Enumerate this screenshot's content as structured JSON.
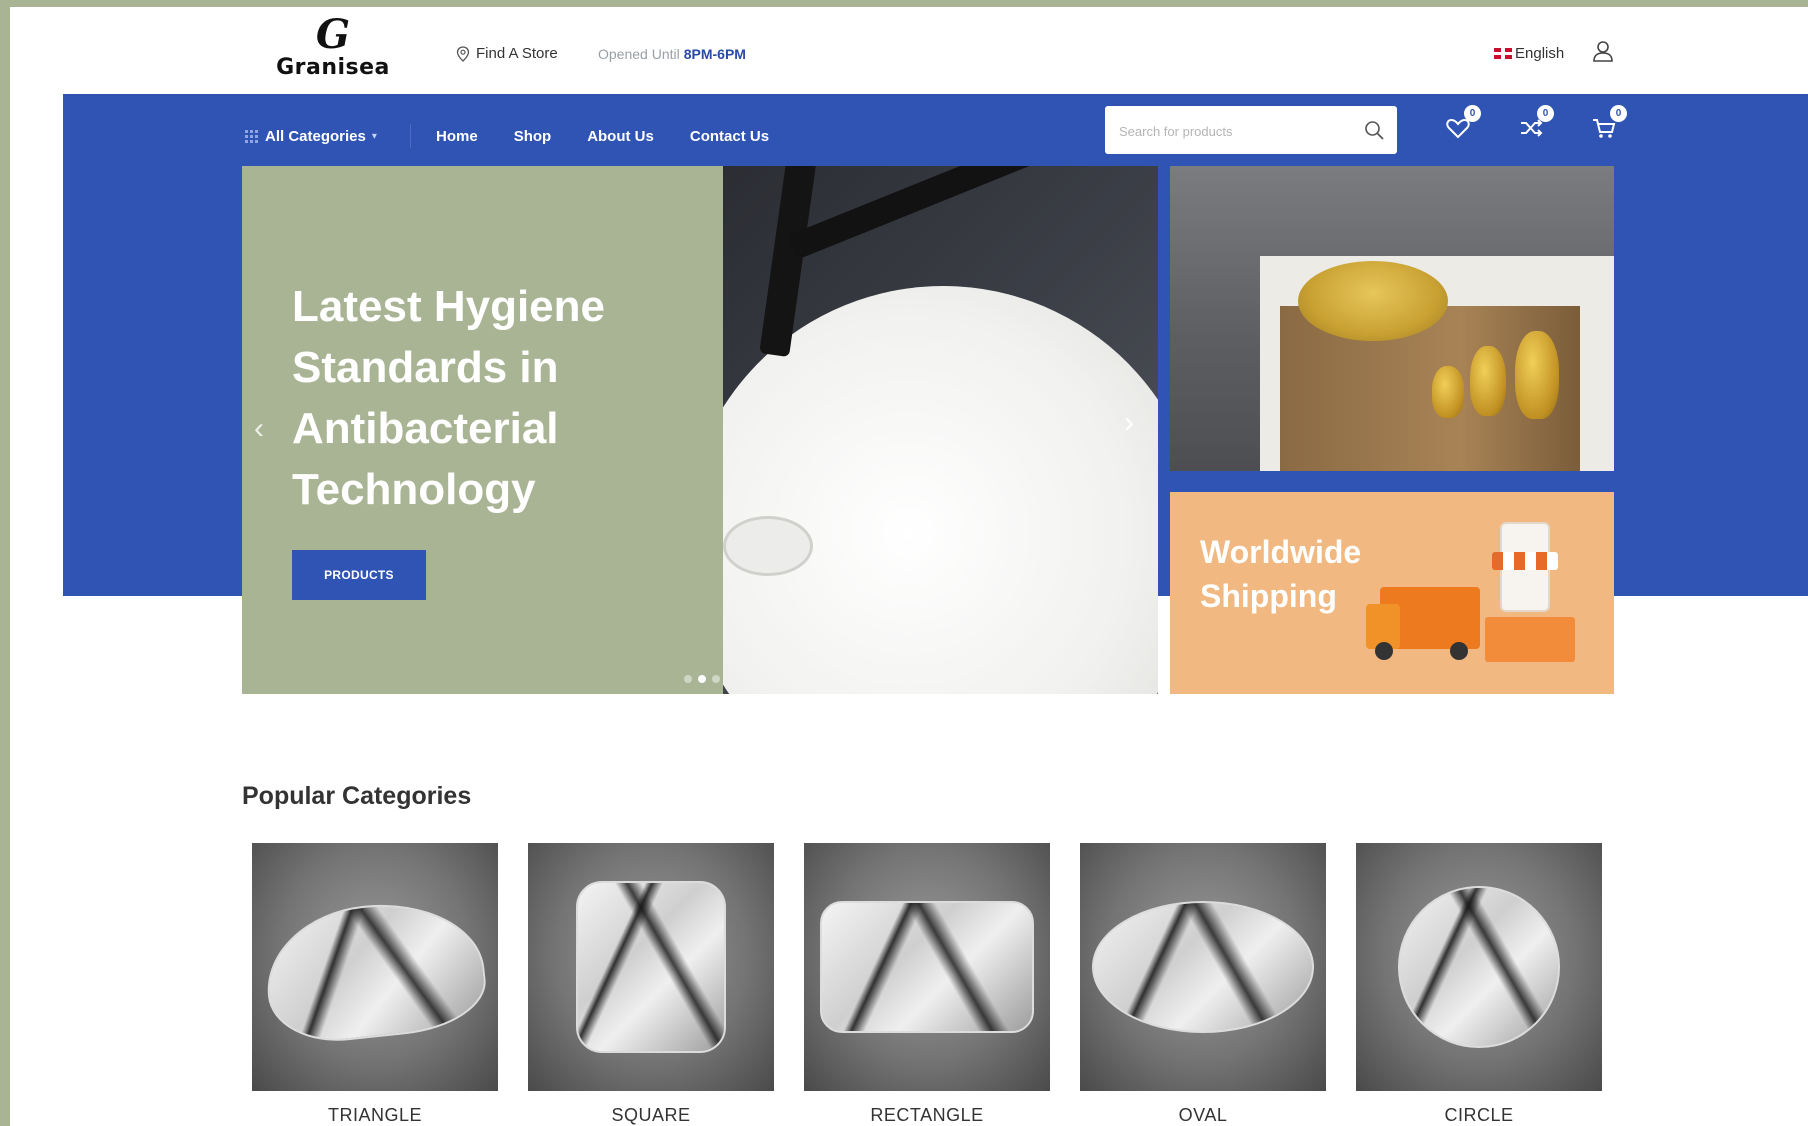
{
  "brand": {
    "logo_mark": "G",
    "logo_text": "Granisea"
  },
  "topbar": {
    "find_store": "Find A Store",
    "hours_label": "Opened Until",
    "hours_value": "8PM-6PM",
    "language": "English"
  },
  "nav": {
    "all_categories": "All Categories",
    "links": [
      "Home",
      "Shop",
      "About Us",
      "Contact Us"
    ],
    "search_placeholder": "Search for products",
    "wishlist_count": "0",
    "compare_count": "0",
    "cart_count": "0"
  },
  "hero": {
    "title": "Latest Hygiene Standards in Antibacterial Technology",
    "button": "PRODUCTS",
    "prev": "‹",
    "next": "›"
  },
  "banners": {
    "shipping_title": "Worldwide Shipping"
  },
  "popular": {
    "title": "Popular Categories",
    "items": [
      "TRIANGLE",
      "SQUARE",
      "RECTANGLE",
      "OVAL",
      "CIRCLE"
    ]
  },
  "colors": {
    "brand_blue": "#2f54b3",
    "sage": "#a9b494",
    "peach": "#f1b981"
  }
}
